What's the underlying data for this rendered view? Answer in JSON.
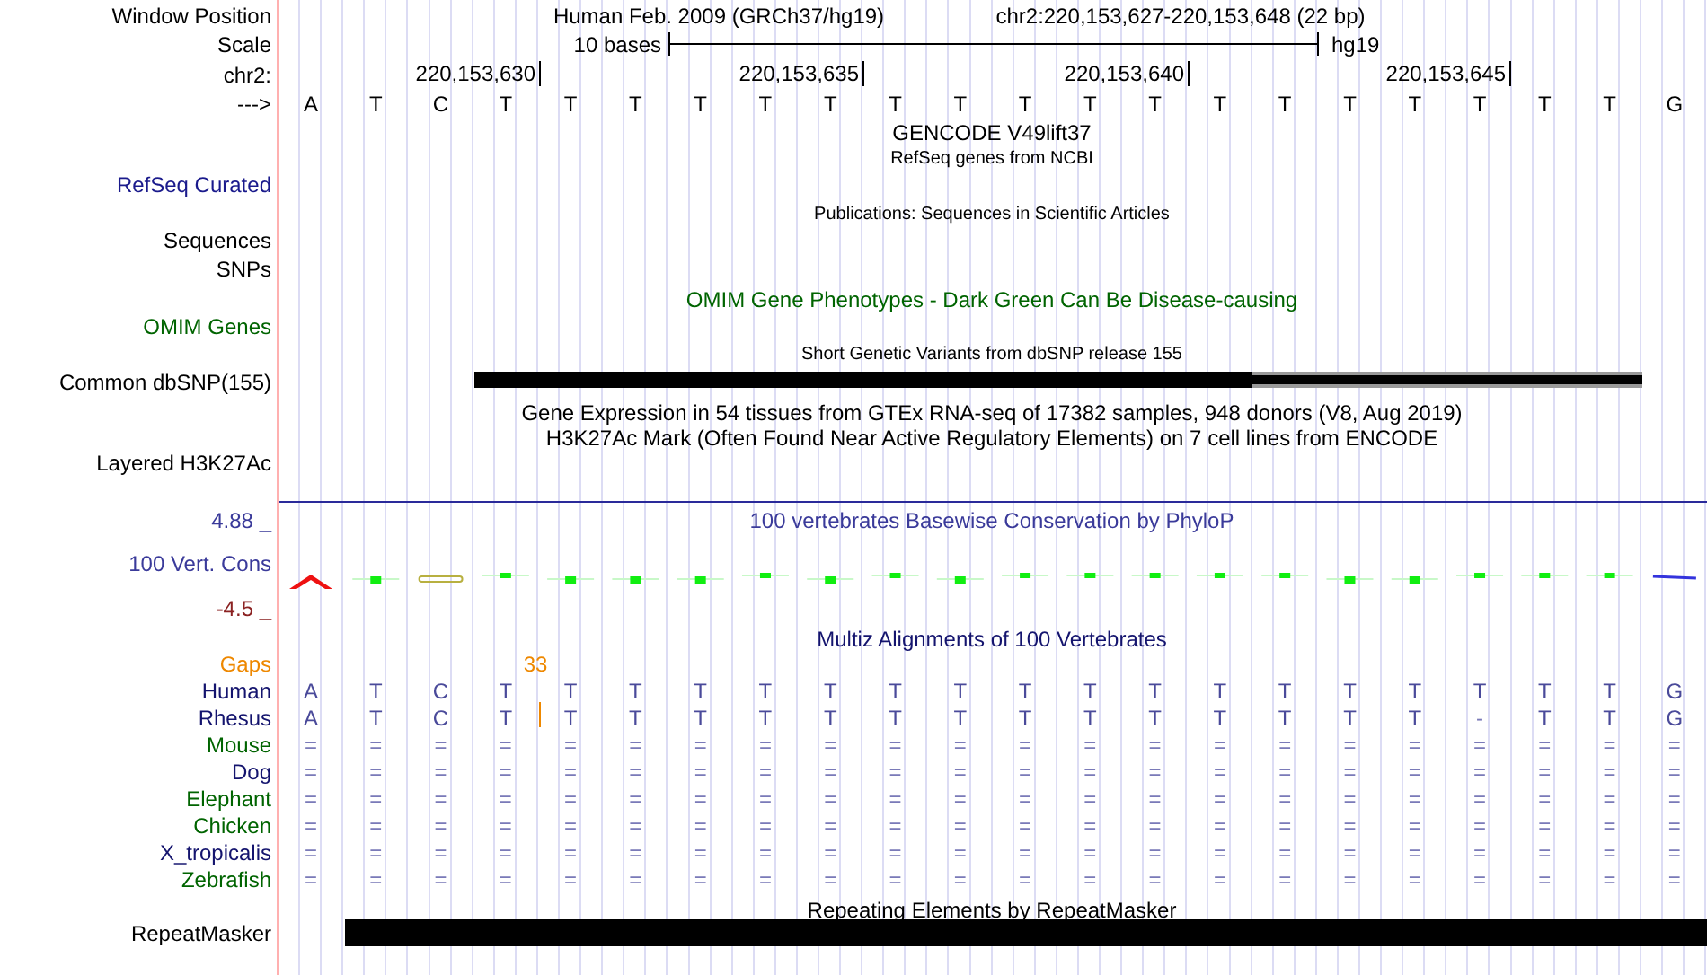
{
  "position": {
    "label": "Window Position",
    "assembly": "Human Feb. 2009 (GRCh37/hg19)",
    "range": "chr2:220,153,627-220,153,648 (22 bp)"
  },
  "scale": {
    "label": "Scale",
    "span": "10 bases",
    "assembly": "hg19"
  },
  "ruler": {
    "label": "chr2:",
    "ticks": [
      "220,153,630",
      "220,153,635",
      "220,153,640",
      "220,153,645"
    ]
  },
  "sequence": {
    "label": "--->",
    "bases": [
      "A",
      "T",
      "C",
      "T",
      "T",
      "T",
      "T",
      "T",
      "T",
      "T",
      "T",
      "T",
      "T",
      "T",
      "T",
      "T",
      "T",
      "T",
      "T",
      "T",
      "T",
      "G"
    ]
  },
  "track_titles": [
    {
      "text": "GENCODE V49lift37",
      "kind": "title",
      "color": "#000000"
    },
    {
      "text": "RefSeq genes from NCBI",
      "kind": "subtitle",
      "color": "#000000"
    },
    {
      "text": "Publications: Sequences in Scientific Articles",
      "kind": "subtitle",
      "color": "#000000"
    },
    {
      "text": "OMIM Gene Phenotypes - Dark Green Can Be Disease-causing",
      "kind": "title",
      "color": "#006400"
    },
    {
      "text": "Short Genetic Variants from dbSNP release 155",
      "kind": "subtitle",
      "color": "#000000"
    },
    {
      "text": "Gene Expression in 54 tissues from GTEx RNA-seq of 17382 samples, 948 donors (V8, Aug 2019)",
      "kind": "title",
      "color": "#000000"
    },
    {
      "text": "H3K27Ac Mark (Often Found Near Active Regulatory Elements) on 7 cell lines from ENCODE",
      "kind": "title",
      "color": "#000000"
    },
    {
      "text": "100 vertebrates Basewise Conservation by PhyloP",
      "kind": "title",
      "color": "#3a3a9a"
    },
    {
      "text": "Multiz Alignments of 100 Vertebrates",
      "kind": "title",
      "color": "#14146e"
    },
    {
      "text": "Repeating Elements by RepeatMasker",
      "kind": "title",
      "color": "#000000"
    }
  ],
  "track_labels": [
    {
      "text": "RefSeq Curated",
      "color": "#1a1a8c"
    },
    {
      "text": "Sequences",
      "color": "#000000"
    },
    {
      "text": "SNPs",
      "color": "#000000"
    },
    {
      "text": "OMIM Genes",
      "color": "#006400"
    },
    {
      "text": "Common dbSNP(155)",
      "color": "#000000"
    },
    {
      "text": "Layered H3K27Ac",
      "color": "#000000"
    },
    {
      "text": "100 Vert. Cons",
      "color": "#3a3a9a"
    }
  ],
  "conservation": {
    "max": "4.88 _",
    "min": "-4.5 _"
  },
  "alignment": {
    "gaps": {
      "label": "Gaps",
      "count": "33"
    },
    "species": [
      {
        "name": "Human",
        "color": "#14146e",
        "bases": [
          "A",
          "T",
          "C",
          "T",
          "T",
          "T",
          "T",
          "T",
          "T",
          "T",
          "T",
          "T",
          "T",
          "T",
          "T",
          "T",
          "T",
          "T",
          "T",
          "T",
          "T",
          "G"
        ]
      },
      {
        "name": "Rhesus",
        "color": "#14146e",
        "bases": [
          "A",
          "T",
          "C",
          "T",
          "T",
          "T",
          "T",
          "T",
          "T",
          "T",
          "T",
          "T",
          "T",
          "T",
          "T",
          "T",
          "T",
          "T",
          "-",
          "T",
          "T",
          "G"
        ]
      },
      {
        "name": "Mouse",
        "color": "#006400",
        "bases": [
          "=",
          "=",
          "=",
          "=",
          "=",
          "=",
          "=",
          "=",
          "=",
          "=",
          "=",
          "=",
          "=",
          "=",
          "=",
          "=",
          "=",
          "=",
          "=",
          "=",
          "=",
          "="
        ]
      },
      {
        "name": "Dog",
        "color": "#14146e",
        "bases": [
          "=",
          "=",
          "=",
          "=",
          "=",
          "=",
          "=",
          "=",
          "=",
          "=",
          "=",
          "=",
          "=",
          "=",
          "=",
          "=",
          "=",
          "=",
          "=",
          "=",
          "=",
          "="
        ]
      },
      {
        "name": "Elephant",
        "color": "#006400",
        "bases": [
          "=",
          "=",
          "=",
          "=",
          "=",
          "=",
          "=",
          "=",
          "=",
          "=",
          "=",
          "=",
          "=",
          "=",
          "=",
          "=",
          "=",
          "=",
          "=",
          "=",
          "=",
          "="
        ]
      },
      {
        "name": "Chicken",
        "color": "#006400",
        "bases": [
          "=",
          "=",
          "=",
          "=",
          "=",
          "=",
          "=",
          "=",
          "=",
          "=",
          "=",
          "=",
          "=",
          "=",
          "=",
          "=",
          "=",
          "=",
          "=",
          "=",
          "=",
          "="
        ]
      },
      {
        "name": "X_tropicalis",
        "color": "#14146e",
        "bases": [
          "=",
          "=",
          "=",
          "=",
          "=",
          "=",
          "=",
          "=",
          "=",
          "=",
          "=",
          "=",
          "=",
          "=",
          "=",
          "=",
          "=",
          "=",
          "=",
          "=",
          "=",
          "="
        ]
      },
      {
        "name": "Zebrafish",
        "color": "#006400",
        "bases": [
          "=",
          "=",
          "=",
          "=",
          "=",
          "=",
          "=",
          "=",
          "=",
          "=",
          "=",
          "=",
          "=",
          "=",
          "=",
          "=",
          "=",
          "=",
          "=",
          "=",
          "=",
          "="
        ]
      }
    ]
  },
  "repeats": {
    "label": "RepeatMasker"
  }
}
